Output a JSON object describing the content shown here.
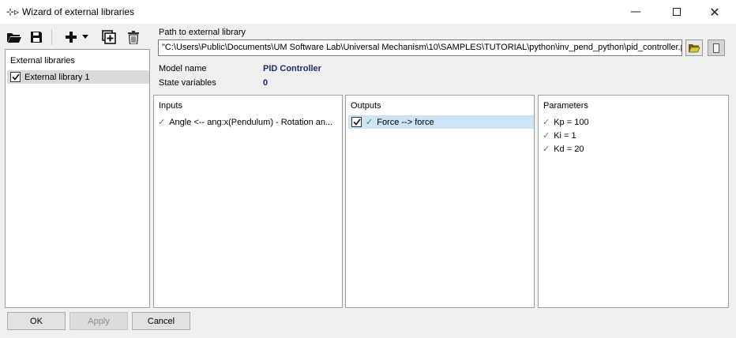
{
  "window": {
    "title": "Wizard of external libraries",
    "icon": "wizard-icon"
  },
  "toolbar": {
    "open": "folder-open-icon",
    "save": "floppy-save-icon",
    "add": "plus-icon",
    "add_dropdown": "chevron-down-icon",
    "add_copy": "add-copy-icon",
    "delete": "trash-icon"
  },
  "libraries": {
    "header": "External libraries",
    "items": [
      {
        "label": "External library 1",
        "checked": true
      }
    ]
  },
  "path": {
    "label": "Path to external library",
    "value": "\"C:\\Users\\Public\\Documents\\UM Software Lab\\Universal Mechanism\\10\\SAMPLES\\TUTORIAL\\python\\inv_pend_python\\pid_controller.py\""
  },
  "model": {
    "name_label": "Model name",
    "name_value": "PID Controller",
    "state_label": "State variables",
    "state_value": "0"
  },
  "inputs": {
    "title": "Inputs",
    "items": [
      "Angle <-- ang:x(Pendulum) - Rotation an..."
    ]
  },
  "outputs": {
    "title": "Outputs",
    "items": [
      {
        "label": "Force --> force",
        "checked": true
      }
    ]
  },
  "parameters": {
    "title": "Parameters",
    "items": [
      "Kp = 100",
      "Ki = 1",
      "Kd = 20"
    ]
  },
  "buttons": {
    "ok": "OK",
    "apply": "Apply",
    "cancel": "Cancel"
  },
  "colors": {
    "selection": "#cde4f7",
    "check": "#3c8f3c",
    "model_value": "#1a2e6e"
  }
}
